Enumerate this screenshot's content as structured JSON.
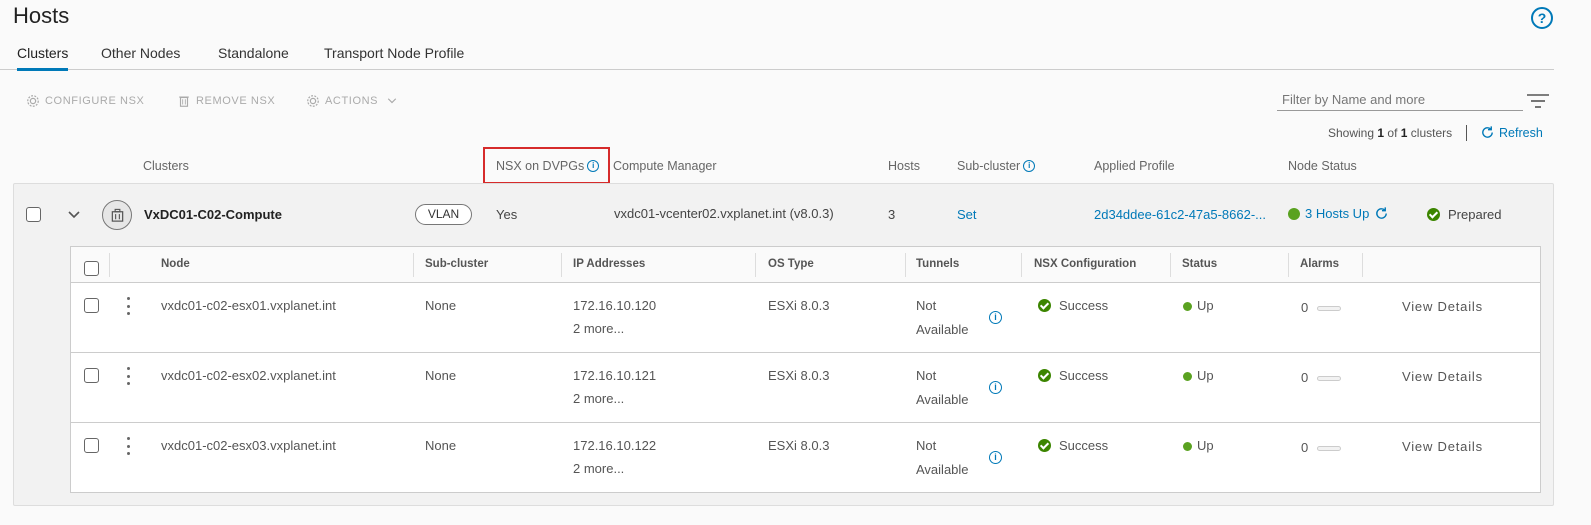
{
  "page": {
    "title": "Hosts"
  },
  "tabs": [
    {
      "label": "Clusters",
      "active": true
    },
    {
      "label": "Other Nodes",
      "active": false
    },
    {
      "label": "Standalone",
      "active": false
    },
    {
      "label": "Transport Node Profile",
      "active": false
    }
  ],
  "toolbar": {
    "configure_label": "CONFIGURE NSX",
    "remove_label": "REMOVE NSX",
    "actions_label": "ACTIONS",
    "filter_placeholder": "Filter by Name and more"
  },
  "summary": {
    "prefix": "Showing ",
    "current": "1",
    "middle": " of ",
    "total": "1",
    "suffix": " clusters",
    "refresh_label": "Refresh"
  },
  "cluster_columns": {
    "clusters": "Clusters",
    "nsx_on_dvpgs": "NSX on DVPGs",
    "compute_manager": "Compute Manager",
    "hosts": "Hosts",
    "sub_cluster": "Sub-cluster",
    "applied_profile": "Applied Profile",
    "node_status": "Node Status"
  },
  "cluster": {
    "name": "VxDC01-C02-Compute",
    "badge": "VLAN",
    "nsx_on_dvpgs": "Yes",
    "compute_manager": "vxdc01-vcenter02.vxplanet.int (v8.0.3)",
    "hosts": "3",
    "sub_cluster": "Set",
    "applied_profile": "2d34ddee-61c2-47a5-8662-...",
    "hosts_up": "3 Hosts Up",
    "status": "Prepared"
  },
  "node_columns": [
    "Node",
    "Sub-cluster",
    "IP Addresses",
    "OS Type",
    "Tunnels",
    "NSX Configuration",
    "Status",
    "Alarms"
  ],
  "nodes": [
    {
      "node": "vxdc01-c02-esx01.vxplanet.int",
      "sub_cluster": "None",
      "ip": "172.16.10.120",
      "more": "2 more...",
      "os": "ESXi 8.0.3",
      "tunnels_line1": "Not",
      "tunnels_line2": "Available",
      "nsx_config": "Success",
      "status": "Up",
      "alarms": "0",
      "action": "View Details"
    },
    {
      "node": "vxdc01-c02-esx02.vxplanet.int",
      "sub_cluster": "None",
      "ip": "172.16.10.121",
      "more": "2 more...",
      "os": "ESXi 8.0.3",
      "tunnels_line1": "Not",
      "tunnels_line2": "Available",
      "nsx_config": "Success",
      "status": "Up",
      "alarms": "0",
      "action": "View Details"
    },
    {
      "node": "vxdc01-c02-esx03.vxplanet.int",
      "sub_cluster": "None",
      "ip": "172.16.10.122",
      "more": "2 more...",
      "os": "ESXi 8.0.3",
      "tunnels_line1": "Not",
      "tunnels_line2": "Available",
      "nsx_config": "Success",
      "status": "Up",
      "alarms": "0",
      "action": "View Details"
    }
  ],
  "colors": {
    "accent": "#0079b8",
    "success": "#3c8500",
    "up": "#5aa220",
    "highlight": "#d62b2b"
  },
  "icons": {
    "help": "help-icon",
    "configure": "gear-icon",
    "remove": "trash-icon",
    "actions": "gear-icon",
    "filter": "filter-icon",
    "refresh": "refresh-icon",
    "cluster": "cluster-icon"
  }
}
